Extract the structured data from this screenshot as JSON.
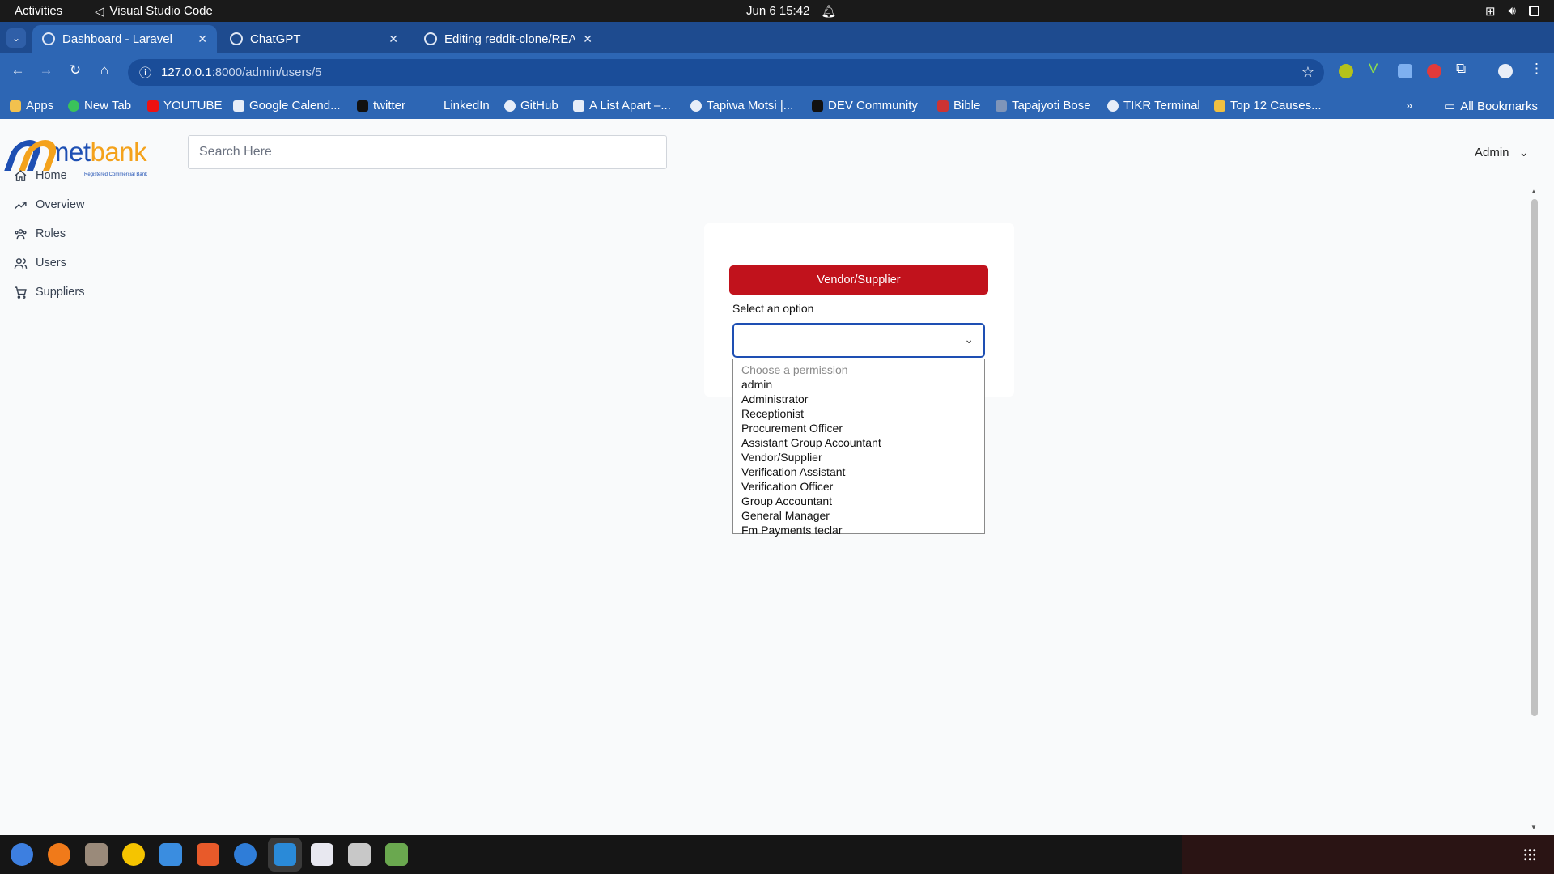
{
  "system": {
    "activities": "Activities",
    "app_name": "Visual Studio Code",
    "clock": "Jun 6  15:42"
  },
  "browser": {
    "tabs": [
      {
        "label": "Dashboard - Laravel",
        "active": true
      },
      {
        "label": "ChatGPT",
        "active": false
      },
      {
        "label": "Editing reddit-clone/REA",
        "active": false
      }
    ],
    "url_host": "127.0.0.1",
    "url_path": ":8000/admin/users/5",
    "bookmarks": [
      "Apps",
      "New Tab",
      "YOUTUBE",
      "Google Calend...",
      "twitter",
      "LinkedIn",
      "GitHub",
      "A List Apart –...",
      "Tapiwa Motsi |...",
      "DEV Community",
      "Bible",
      "Tapajyoti Bose",
      "TIKR Terminal",
      "Top 12 Causes..."
    ],
    "more_bookmarks": "»",
    "all_bookmarks": "All Bookmarks"
  },
  "header": {
    "logo_prefix": "met",
    "logo_suffix": "bank",
    "logo_tagline": "Registered Commercial Bank",
    "search_placeholder": "Search Here",
    "user_menu": "Admin"
  },
  "sidebar": {
    "items": [
      {
        "label": "Home",
        "icon": "home-icon"
      },
      {
        "label": "Overview",
        "icon": "trend-icon"
      },
      {
        "label": "Roles",
        "icon": "roles-icon"
      },
      {
        "label": "Users",
        "icon": "users-icon"
      },
      {
        "label": "Suppliers",
        "icon": "cart-icon"
      }
    ]
  },
  "main": {
    "role_button": "Vendor/Supplier",
    "select_label": "Select an option",
    "dropdown": {
      "placeholder": "Choose a permission",
      "options": [
        "admin",
        "Administrator",
        "Receptionist",
        "Procurement Officer",
        "Assistant Group Accountant",
        "Vendor/Supplier",
        "Verification Assistant",
        "Verification Officer",
        "Group Accountant",
        "General Manager",
        "Fm Payments teclar"
      ]
    }
  },
  "colors": {
    "brand_blue": "#1e4fb3",
    "brand_orange": "#f4a21c",
    "role_button_red": "#c1121c",
    "browser_chrome": "#2d66b4"
  }
}
